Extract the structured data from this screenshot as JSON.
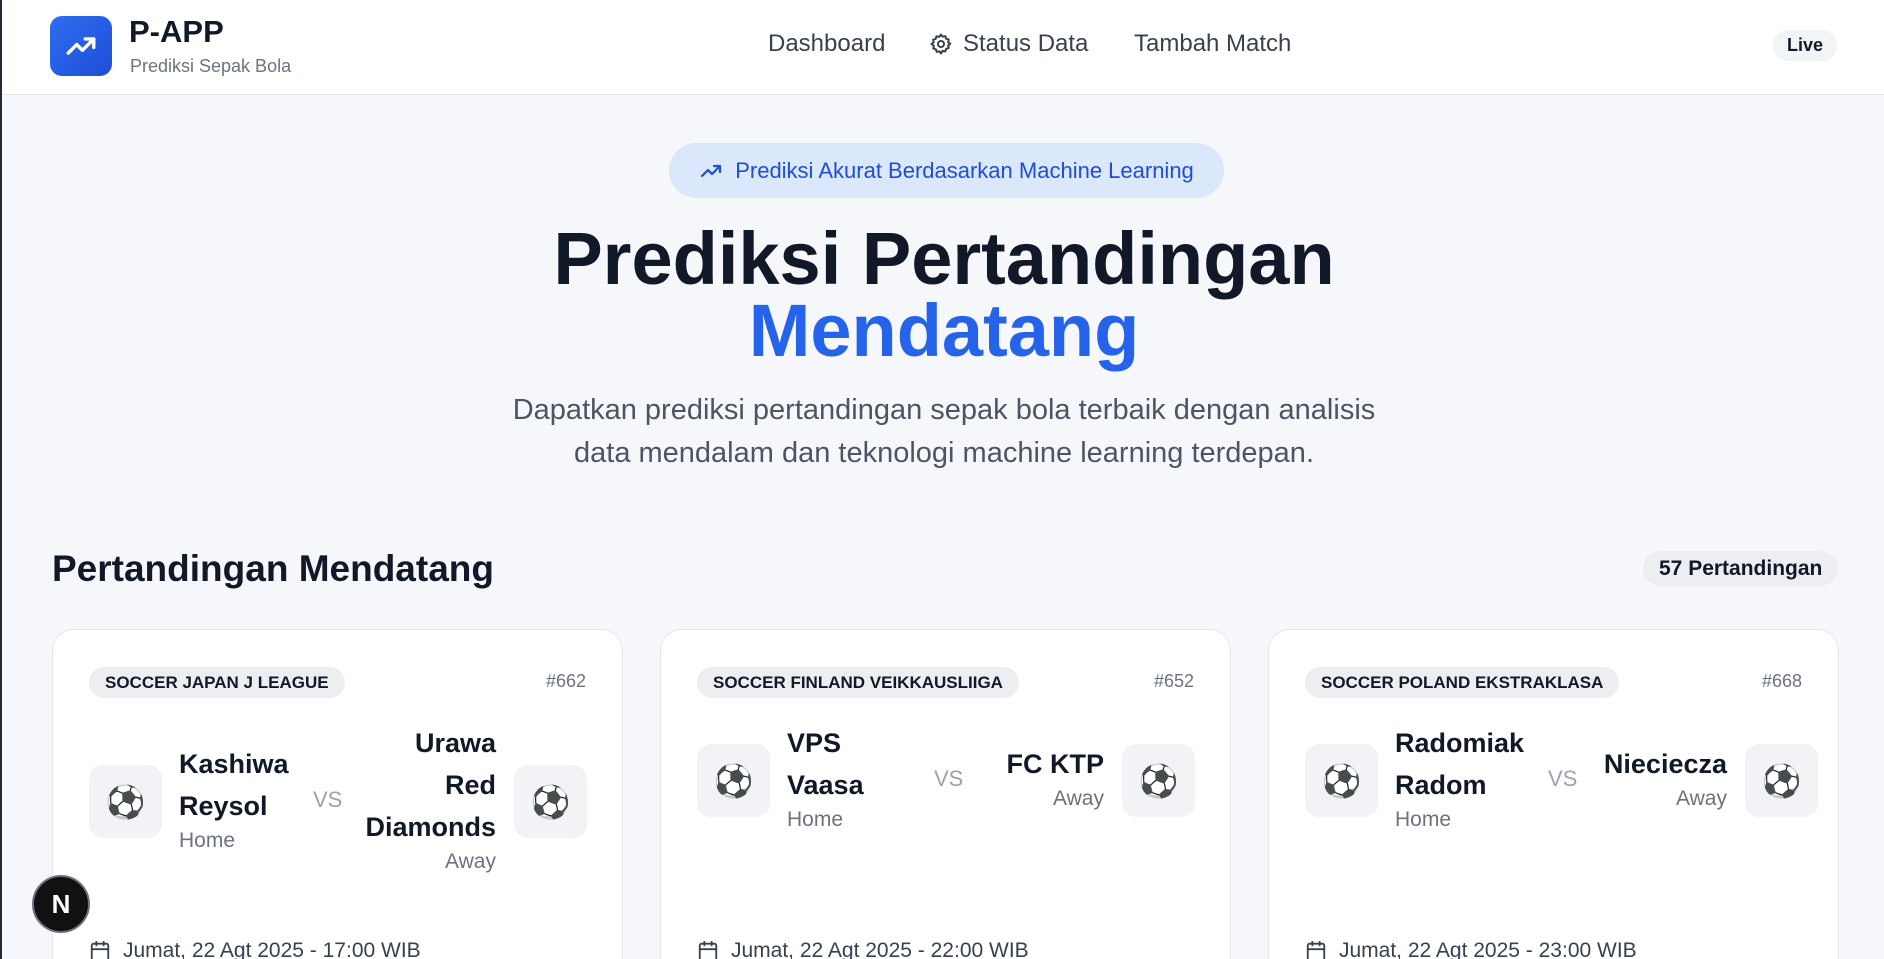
{
  "header": {
    "brand_title": "P-APP",
    "brand_subtitle": "Prediksi Sepak Bola",
    "nav": {
      "dashboard": "Dashboard",
      "status_data": "Status Data",
      "tambah_match": "Tambah Match"
    },
    "live_label": "Live"
  },
  "hero": {
    "pill_text": "Prediksi Akurat Berdasarkan Machine Learning",
    "title_line1": "Prediksi Pertandingan",
    "title_line2": "Mendatang",
    "description_line1": "Dapatkan prediksi pertandingan sepak bola terbaik dengan analisis",
    "description_line2": "data mendalam dan teknologi machine learning terdepan."
  },
  "section": {
    "title": "Pertandingan Mendatang",
    "count_label": "57 Pertandingan"
  },
  "matches": [
    {
      "league": "SOCCER JAPAN J LEAGUE",
      "id": "#662",
      "home_lines": [
        "Kashiwa",
        "Reysol"
      ],
      "home_role": "Home",
      "away_lines": [
        "Urawa",
        "Red",
        "Diamonds"
      ],
      "away_role": "Away",
      "vs": "VS",
      "datetime": "Jumat, 22 Agt 2025 - 17:00 WIB"
    },
    {
      "league": "SOCCER FINLAND VEIKKAUSLIIGA",
      "id": "#652",
      "home_lines": [
        "VPS",
        "Vaasa"
      ],
      "home_role": "Home",
      "away_lines": [
        "FC KTP"
      ],
      "away_role": "Away",
      "vs": "VS",
      "datetime": "Jumat, 22 Agt 2025 - 22:00 WIB"
    },
    {
      "league": "SOCCER POLAND EKSTRAKLASA",
      "id": "#668",
      "home_lines": [
        "Radomiak",
        "Radom"
      ],
      "home_role": "Home",
      "away_lines": [
        "Nieciecza"
      ],
      "away_role": "Away",
      "vs": "VS",
      "datetime": "Jumat, 22 Agt 2025 - 23:00 WIB"
    }
  ],
  "fab_label": "N",
  "colors": {
    "accent": "#2563eb",
    "pill_bg": "#dbe7fb"
  }
}
